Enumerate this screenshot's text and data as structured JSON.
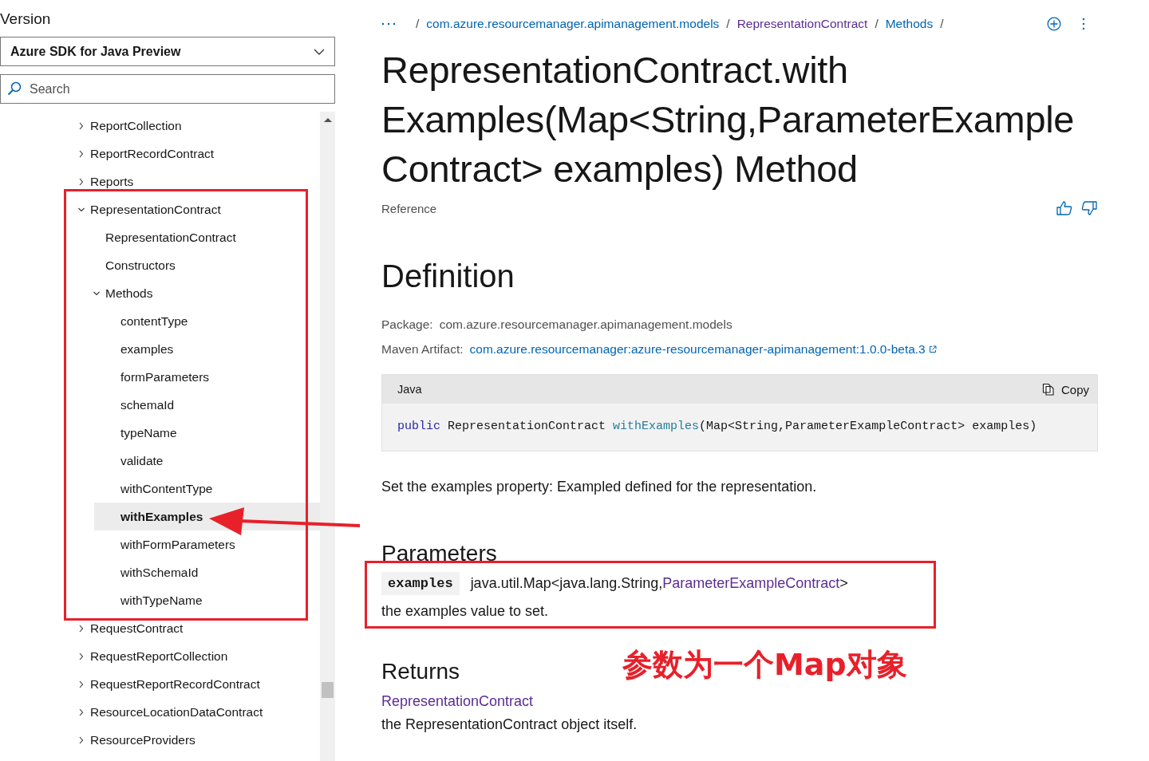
{
  "sidebar": {
    "version_label": "Version",
    "version_dropdown": {
      "value": "Azure SDK for Java Preview"
    },
    "search": {
      "placeholder": "Search"
    },
    "tree": [
      {
        "label": "ReportCollection",
        "expanded": false,
        "selected": false
      },
      {
        "label": "ReportRecordContract",
        "expanded": false,
        "selected": false
      },
      {
        "label": "Reports",
        "expanded": false,
        "selected": false
      },
      {
        "label": "RepresentationContract",
        "expanded": true,
        "selected": false,
        "children": [
          {
            "label": "RepresentationContract",
            "selected": false
          },
          {
            "label": "Constructors",
            "selected": false
          },
          {
            "label": "Methods",
            "expanded": true,
            "selected": false,
            "children": [
              {
                "label": "contentType",
                "selected": false
              },
              {
                "label": "examples",
                "selected": false
              },
              {
                "label": "formParameters",
                "selected": false
              },
              {
                "label": "schemaId",
                "selected": false
              },
              {
                "label": "typeName",
                "selected": false
              },
              {
                "label": "validate",
                "selected": false
              },
              {
                "label": "withContentType",
                "selected": false
              },
              {
                "label": "withExamples",
                "selected": true
              },
              {
                "label": "withFormParameters",
                "selected": false
              },
              {
                "label": "withSchemaId",
                "selected": false
              },
              {
                "label": "withTypeName",
                "selected": false
              }
            ]
          }
        ]
      },
      {
        "label": "RequestContract",
        "expanded": false,
        "selected": false
      },
      {
        "label": "RequestReportCollection",
        "expanded": false,
        "selected": false
      },
      {
        "label": "RequestReportRecordContract",
        "expanded": false,
        "selected": false
      },
      {
        "label": "ResourceLocationDataContract",
        "expanded": false,
        "selected": false
      },
      {
        "label": "ResourceProviders",
        "expanded": false,
        "selected": false
      }
    ]
  },
  "breadcrumb": [
    {
      "label": "com.azure.resourcemanager.apimanagement.models",
      "visited": false
    },
    {
      "label": "RepresentationContract",
      "visited": true
    },
    {
      "label": "Methods",
      "visited": false
    }
  ],
  "breadcrumb_separator": "/",
  "title_lines": [
    "RepresentationContract.with",
    "Examples(Map<String,ParameterExample",
    "Contract> examples) Method"
  ],
  "subtitle": "Reference",
  "definition": {
    "heading": "Definition",
    "package_label": "Package:",
    "package_value": "com.azure.resourcemanager.apimanagement.models",
    "maven_label": "Maven Artifact:",
    "maven_link": "com.azure.resourcemanager:azure-resourcemanager-apimanagement:1.0.0-beta.3"
  },
  "code": {
    "language": "Java",
    "copy_label": "Copy",
    "tokens": [
      {
        "kind": "keyword",
        "text": "public"
      },
      {
        "kind": "plain",
        "text": " RepresentationContract "
      },
      {
        "kind": "method",
        "text": "withExamples"
      },
      {
        "kind": "plain",
        "text": "(Map<String,ParameterExampleContract> examples)"
      }
    ]
  },
  "description": "Set the examples property: Exampled defined for the representation.",
  "parameters": {
    "heading": "Parameters",
    "name": "examples",
    "type_prefix": "java.util.Map<java.lang.String,",
    "type_link": "ParameterExampleContract",
    "type_suffix": ">",
    "description": "the examples value to set."
  },
  "returns": {
    "heading": "Returns",
    "type_link": "RepresentationContract",
    "description": "the RepresentationContract object itself."
  },
  "annotation": {
    "text": "参数为一个Map对象"
  }
}
